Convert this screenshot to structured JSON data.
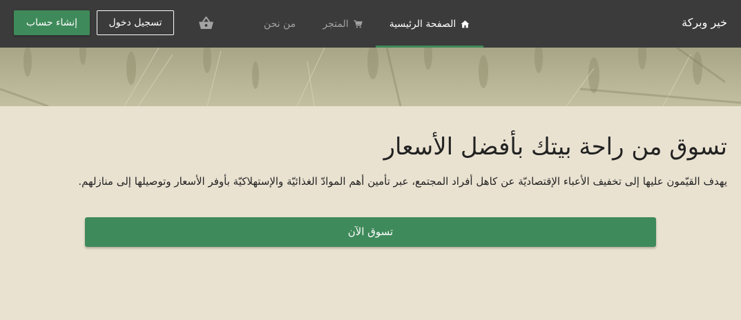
{
  "navbar": {
    "brand": "خير وبركة",
    "items": [
      {
        "label": "الصفحة الرئيسية",
        "icon": "home-icon",
        "active": true
      },
      {
        "label": "المتجر",
        "icon": "cart-icon",
        "active": false
      },
      {
        "label": "من نحن",
        "icon": "",
        "active": false
      }
    ],
    "basket_icon": "basket-icon",
    "login_label": "تسجيل دخول",
    "signup_label": "إنشاء حساب"
  },
  "hero": {
    "background": "wheat-field-banner"
  },
  "main": {
    "title": "تسوق من راحة بيتك بأفضل الأسعار",
    "subtitle": "يهدف القيّمون عليها إلى تخفيف الأعباء الإقتصاديّة عن كاهل أفراد المجتمع، عبر تأمين أهم الموادّ الغذائيّة والإستهلاكيّة بأوفر الأسعار وتوصيلها إلى منازلهم.",
    "cta_label": "تسوق الآن"
  },
  "colors": {
    "navbar_bg": "#3b3b3b",
    "accent": "#3f8a5a",
    "page_bg": "#eae2d1",
    "muted_text": "#a3a3a3"
  }
}
